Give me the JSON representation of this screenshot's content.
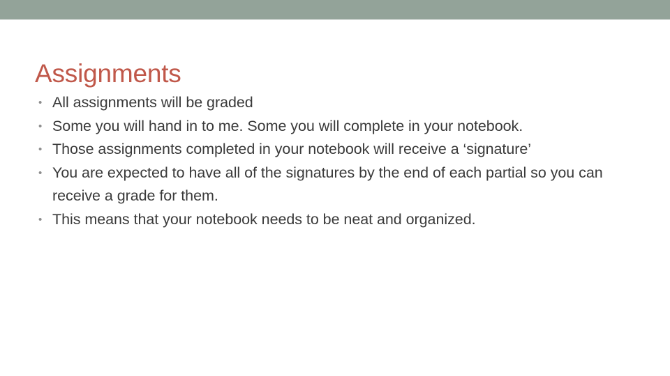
{
  "slide": {
    "title": "Assignments",
    "banner_color": "#93a399",
    "title_color": "#c0584a",
    "body_text_color": "#3a3a3a",
    "bullet_marker_color": "#8d8d8d",
    "background_color": "#ffffff",
    "bullet_glyph": "•",
    "bullets": [
      {
        "text": "All assignments will be graded"
      },
      {
        "text": "Some you will hand in to me. Some you will complete in your notebook."
      },
      {
        "text": "Those assignments completed in your notebook will receive a ‘signature’"
      },
      {
        "text": "You are expected to have all of the signatures by the end of each partial so you can receive a grade for them."
      },
      {
        "text": "This means that your notebook needs to be neat and organized."
      }
    ]
  }
}
